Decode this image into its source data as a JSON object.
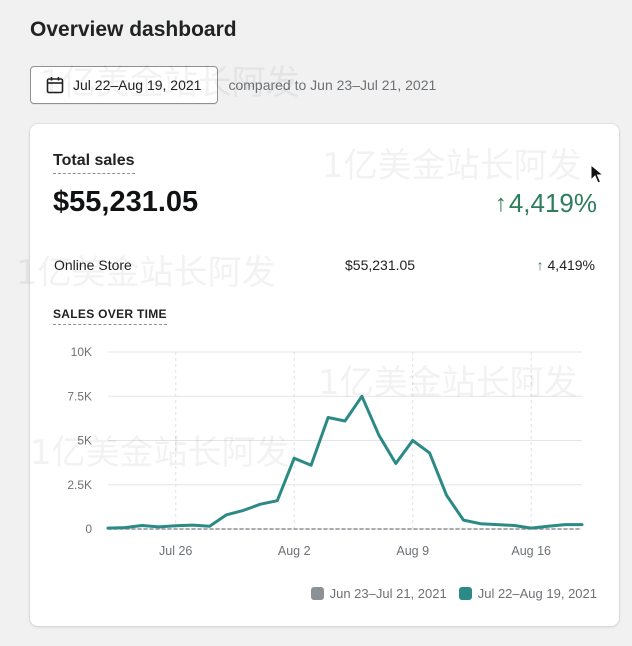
{
  "header": {
    "title": "Overview dashboard"
  },
  "date_filter": {
    "range_label": "Jul 22–Aug 19, 2021",
    "compare_text": "compared to Jun 23–Jul 21, 2021"
  },
  "total_sales": {
    "label": "Total sales",
    "value": "$55,231.05",
    "change": "4,419%",
    "change_color": "#2e7d5b"
  },
  "breakdown": [
    {
      "name": "Online Store",
      "amount": "$55,231.05",
      "change": "4,419%"
    }
  ],
  "sales_over_time": {
    "title": "SALES OVER TIME"
  },
  "legend": [
    {
      "label": "Jun 23–Jul 21, 2021",
      "color": "#8c9196"
    },
    {
      "label": "Jul 22–Aug 19, 2021",
      "color": "#2c8a86"
    }
  ],
  "watermark": "1亿美金站长阿发",
  "chart_data": {
    "type": "line",
    "x_ticks": [
      "Jul 26",
      "Aug 2",
      "Aug 9",
      "Aug 16"
    ],
    "y_ticks": [
      "0",
      "2.5K",
      "5K",
      "7.5K",
      "10K"
    ],
    "ylim": [
      0,
      10000
    ],
    "x_range": [
      "Jul 22",
      "Aug 19"
    ],
    "grid": true,
    "legend_position": "bottom-right",
    "series": [
      {
        "name": "Jun 23–Jul 21, 2021",
        "color": "#8c9196",
        "dashed": true,
        "values": [
          0,
          0,
          0,
          0,
          0,
          0,
          0,
          0,
          0,
          0,
          0,
          0,
          0,
          0,
          0,
          0,
          0,
          0,
          0,
          0,
          0,
          0,
          0,
          0,
          0,
          0,
          0,
          0,
          0
        ]
      },
      {
        "name": "Jul 22–Aug 19, 2021",
        "color": "#2c8a86",
        "dashed": false,
        "values": [
          50,
          80,
          200,
          120,
          180,
          220,
          150,
          800,
          1050,
          1400,
          1600,
          4000,
          3600,
          6300,
          6100,
          7500,
          5300,
          3700,
          5000,
          4300,
          1900,
          500,
          300,
          250,
          200,
          50,
          150,
          250,
          250
        ]
      }
    ]
  }
}
